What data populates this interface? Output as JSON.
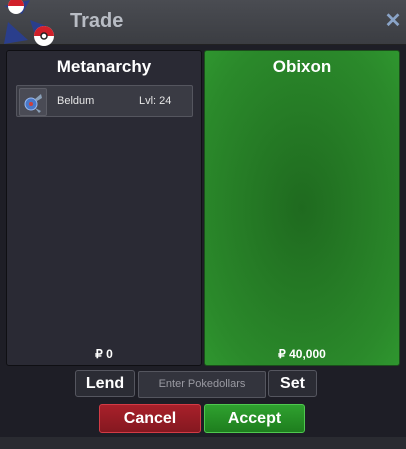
{
  "window": {
    "title": "Trade"
  },
  "trade": {
    "left": {
      "player_name": "Metanarchy",
      "items": [
        {
          "name": "Beldum",
          "level_text": "Lvl: 24",
          "icon": "beldum-icon"
        }
      ],
      "money": "₽ 0"
    },
    "right": {
      "player_name": "Obixon",
      "items": [],
      "money": "₽ 40,000"
    }
  },
  "controls": {
    "lend_label": "Lend",
    "amount_placeholder": "Enter Pokedollars",
    "set_label": "Set",
    "cancel_label": "Cancel",
    "accept_label": "Accept"
  },
  "colors": {
    "panel_bg": "#2a2a34",
    "partner_panel_green": "#2b8a2b",
    "cancel_red": "#a8202a",
    "accept_green": "#2fa12f"
  }
}
